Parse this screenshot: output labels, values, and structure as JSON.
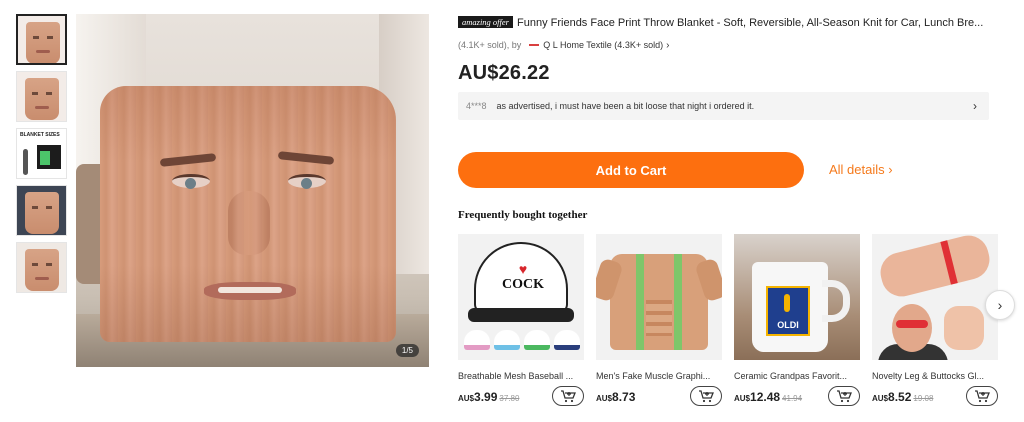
{
  "gallery": {
    "counter": "1/5",
    "size_thumb_label": "BLANKET SIZES"
  },
  "product": {
    "badge": "amazing offer",
    "title": "Funny Friends Face Print Throw Blanket - Soft, Reversible, All-Season Knit for Car, Lunch Bre...",
    "sold": "(4.1K+ sold), by",
    "store": "Q L Home Textile (4.3K+ sold)",
    "price": "AU$26.22"
  },
  "review": {
    "reviewer": "4***8",
    "text": "as advertised, i must have been a bit loose that night i ordered it."
  },
  "actions": {
    "add_to_cart": "Add to Cart",
    "all_details": "All details ›"
  },
  "fbt": {
    "title": "Frequently bought together",
    "items": [
      {
        "name": "Breathable Mesh Baseball ...",
        "currency": "AU$",
        "price": "3.99",
        "old_price": "37.80",
        "image_text": "COCK"
      },
      {
        "name": "Men's Fake Muscle Graphi...",
        "currency": "AU$",
        "price": "8.73",
        "old_price": ""
      },
      {
        "name": "Ceramic Grandpas Favorit...",
        "currency": "AU$",
        "price": "12.48",
        "old_price": "41.94",
        "image_text": "OLDI"
      },
      {
        "name": "Novelty Leg & Buttocks Gl...",
        "currency": "AU$",
        "price": "8.52",
        "old_price": "19.08"
      }
    ]
  },
  "colors": {
    "accent": "#fd6f0f",
    "link": "#f57a1c"
  }
}
